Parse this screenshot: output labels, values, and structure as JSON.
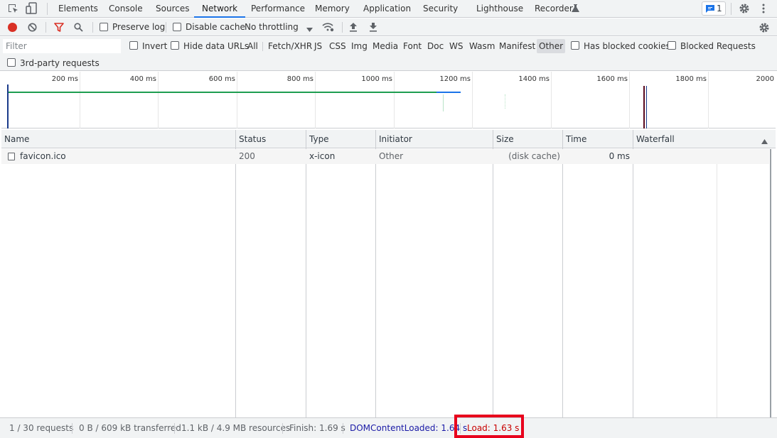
{
  "tabs": [
    "Elements",
    "Console",
    "Sources",
    "Network",
    "Performance",
    "Memory",
    "Application",
    "Security",
    "Lighthouse",
    "Recorder"
  ],
  "selected_tab": "Network",
  "issues_badge_count": "1",
  "toolbar": {
    "preserve_log": "Preserve log",
    "disable_cache": "Disable cache",
    "throttling": "No throttling"
  },
  "filter": {
    "placeholder": "Filter",
    "invert": "Invert",
    "hide_data_urls": "Hide data URLs",
    "types": [
      "All",
      "Fetch/XHR",
      "JS",
      "CSS",
      "Img",
      "Media",
      "Font",
      "Doc",
      "WS",
      "Wasm",
      "Manifest",
      "Other"
    ],
    "active_type": "Other",
    "has_blocked_cookies": "Has blocked cookies",
    "blocked_requests": "Blocked Requests",
    "third_party": "3rd-party requests"
  },
  "overview": {
    "ticks": [
      "200 ms",
      "400 ms",
      "600 ms",
      "800 ms",
      "1000 ms",
      "1200 ms",
      "1400 ms",
      "1600 ms",
      "1800 ms",
      "2000"
    ],
    "colors": {
      "network_bar": "#1e9e50",
      "tail_bar": "#1a73e8",
      "load_marker": "#a50000"
    }
  },
  "table": {
    "columns": [
      "Name",
      "Status",
      "Type",
      "Initiator",
      "Size",
      "Time",
      "Waterfall"
    ],
    "rows": [
      {
        "name": "favicon.ico",
        "status": "200",
        "type": "x-icon",
        "initiator": "Other",
        "size": "(disk cache)",
        "time": "0 ms"
      }
    ]
  },
  "status": {
    "requests": "1 / 30 requests",
    "transferred": "0 B / 609 kB transferred",
    "resources": "1.1 kB / 4.9 MB resources",
    "finish": "Finish: 1.69 s",
    "dom_content_loaded": "DOMContentLoaded: 1.64 s",
    "load": "Load: 1.63 s"
  },
  "colors": {
    "accent": "#1a73e8",
    "record": "#d93025",
    "highlight": "#e8001c"
  }
}
